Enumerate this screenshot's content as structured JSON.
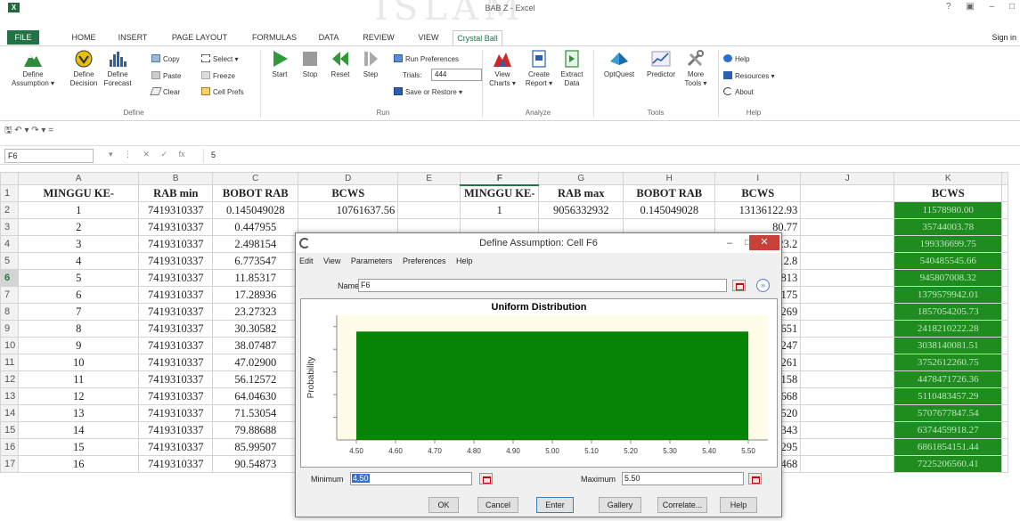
{
  "window": {
    "title": "BAB Z - Excel",
    "controls": "? ▣ – □",
    "app_logo": "X",
    "sign_in": "Sign in",
    "watermark": "ISLAM"
  },
  "tabs": [
    "FILE",
    "HOME",
    "INSERT",
    "PAGE LAYOUT",
    "FORMULAS",
    "DATA",
    "REVIEW",
    "VIEW",
    "Crystal Ball"
  ],
  "ribbon": {
    "define_assumption": "Define Assumption ▾",
    "define_assumption_l1": "Define",
    "define_assumption_l2": "Assumption ▾",
    "define_decision_l1": "Define",
    "define_decision_l2": "Decision",
    "define_forecast_l1": "Define",
    "define_forecast_l2": "Forecast",
    "copy": "Copy",
    "paste": "Paste",
    "clear": "Clear",
    "select": "Select ▾",
    "freeze": "Freeze",
    "cell_prefs": "Cell Prefs",
    "group_define": "Define",
    "start": "Start",
    "stop": "Stop",
    "reset": "Reset",
    "step": "Step",
    "run_preferences": "Run Preferences",
    "trials_label": "Trials:",
    "trials_value": "444",
    "save_or_restore": "Save or Restore ▾",
    "group_run": "Run",
    "view_charts_l1": "View",
    "view_charts_l2": "Charts ▾",
    "create_report_l1": "Create",
    "create_report_l2": "Report ▾",
    "extract_data_l1": "Extract",
    "extract_data_l2": "Data",
    "group_analyze": "Analyze",
    "optquest": "OptQuest",
    "predictor": "Predictor",
    "more_tools_l1": "More",
    "more_tools_l2": "Tools ▾",
    "group_tools": "Tools",
    "help": "Help",
    "resources": "Resources ▾",
    "about": "About",
    "group_help": "Help"
  },
  "qat": "🖫  ↶ ▾  ↷ ▾   =",
  "formula_bar": {
    "name_box": "F6",
    "icons": "▾ ⋮ ✕ ✓ fx",
    "value": "5"
  },
  "grid": {
    "col_letters": [
      "A",
      "B",
      "C",
      "D",
      "E",
      "F",
      "G",
      "H",
      "I",
      "J",
      "K"
    ],
    "row_numbers": [
      "1",
      "2",
      "3",
      "4",
      "5",
      "6",
      "7",
      "8",
      "9",
      "10",
      "11",
      "12",
      "13",
      "14",
      "15",
      "16",
      "17"
    ],
    "headers": [
      "MINGGU KE-",
      "RAB min",
      "BOBOT RAB",
      "BCWS",
      "",
      "MINGGU KE-",
      "RAB max",
      "BOBOT RAB",
      "BCWS",
      "",
      "BCWS"
    ],
    "rows": [
      [
        "1",
        "7419310337",
        "0.145049028",
        "10761637.56",
        "",
        "1",
        "9056332932",
        "0.145049028",
        "13136122.93",
        "",
        "11578980.00"
      ],
      [
        "2",
        "7419310337",
        "0.447955",
        "",
        "",
        "",
        "",
        "",
        "80.77",
        "",
        "35744003.78"
      ],
      [
        "3",
        "7419310337",
        "2.498154",
        "",
        "",
        "",
        "",
        "",
        "223.2",
        "",
        "199336699.75"
      ],
      [
        "4",
        "7419310337",
        "6.773547",
        "",
        "",
        "",
        "",
        "",
        "012.8",
        "",
        "540485545.66"
      ],
      [
        "5",
        "7419310337",
        "11.85317",
        "",
        "",
        "",
        "",
        "",
        "2813",
        "",
        "945807008.32"
      ],
      [
        "6",
        "7419310337",
        "17.28936",
        "",
        "",
        "",
        "",
        "",
        "2175",
        "",
        "1379579942.01"
      ],
      [
        "7",
        "7419310337",
        "23.27323",
        "",
        "",
        "",
        "",
        "",
        "1269",
        "",
        "1857054205.73"
      ],
      [
        "8",
        "7419310337",
        "30.30582",
        "",
        "",
        "",
        "",
        "",
        "6651",
        "",
        "2418210222.28"
      ],
      [
        "9",
        "7419310337",
        "38.07487",
        "",
        "",
        "",
        "",
        "",
        "7247",
        "",
        "3038140081.51"
      ],
      [
        "10",
        "7419310337",
        "47.02900",
        "",
        "",
        "",
        "",
        "",
        "3261",
        "",
        "3752612260.75"
      ],
      [
        "11",
        "7419310337",
        "56.12572",
        "",
        "",
        "",
        "",
        "",
        "2158",
        "",
        "4478471726.36"
      ],
      [
        "12",
        "7419310337",
        "64.04630",
        "",
        "",
        "",
        "",
        "",
        "6668",
        "",
        "5110483457.29"
      ],
      [
        "13",
        "7419310337",
        "71.53054",
        "",
        "",
        "",
        "",
        "",
        "4520",
        "",
        "5707677847.54"
      ],
      [
        "14",
        "7419310337",
        "79.88688",
        "",
        "",
        "",
        "",
        "",
        "2343",
        "",
        "6374459918.27"
      ],
      [
        "15",
        "7419310337",
        "85.99507",
        "",
        "",
        "",
        "",
        "",
        "0295",
        "",
        "6861854151.44"
      ],
      [
        "16",
        "7419310337",
        "90.54873",
        "",
        "",
        "",
        "",
        "",
        "4468",
        "",
        "7225206560.41"
      ]
    ]
  },
  "dialog": {
    "title": "Define Assumption: Cell F6",
    "min_glyph": "–",
    "max_glyph": "□",
    "close_glyph": "✕",
    "menu": [
      "Edit",
      "View",
      "Parameters",
      "Preferences",
      "Help"
    ],
    "name_label": "Name:",
    "name_value": "F6",
    "expand_glyph": "»",
    "minimum_label": "Minimum",
    "minimum_value": "4.50",
    "maximum_label": "Maximum",
    "maximum_value": "5.50",
    "buttons": [
      "OK",
      "Cancel",
      "Enter",
      "Gallery",
      "Correlate...",
      "Help"
    ]
  },
  "chart_data": {
    "type": "area",
    "title": "Uniform Distribution",
    "xlabel": "",
    "ylabel": "Probability",
    "x_ticks": [
      "4.50",
      "4.60",
      "4.70",
      "4.80",
      "4.90",
      "5.00",
      "5.10",
      "5.20",
      "5.30",
      "5.40",
      "5.50"
    ],
    "xlim": [
      4.45,
      5.55
    ],
    "ylim": [
      0,
      1.15
    ],
    "uniform_min": 4.5,
    "uniform_max": 5.5,
    "density": 1.0,
    "fill_color": "#058405",
    "plot_bg": "#fffde8",
    "grid": false
  },
  "colors": {
    "excel_green": "#217346",
    "close_red": "#c7413a",
    "highlight_green": "#1e8c1e"
  }
}
